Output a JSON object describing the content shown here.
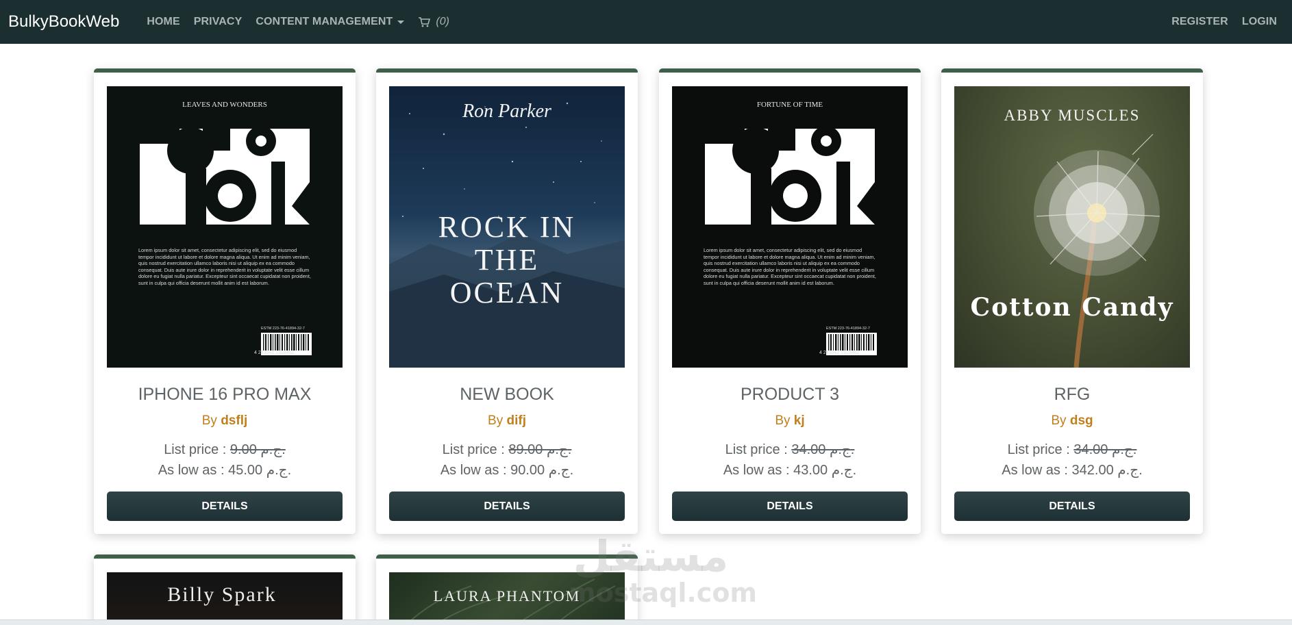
{
  "navbar": {
    "brand": "BulkyBookWeb",
    "links": [
      "HOME",
      "PRIVACY",
      "CONTENT MANAGEMENT"
    ],
    "cart_count": "(0)",
    "right_links": [
      "REGISTER",
      "LOGIN"
    ]
  },
  "products": [
    {
      "cover": {
        "line1": "LEAVES AND WONDERS",
        "big": "BOOK",
        "blurb": "Lorem ipsum dolor sit amet, consectetur adipiscing elit, sed do eiusmod tempor incididunt ut labore et dolore magna aliqua. Ut enim ad minim veniam, quis nostrud exercitation ullamco laboris nisi ut aliquip ex ea commodo consequat. Duis aute irure dolor in reprehenderit in voluptate velit esse cillum dolore eu fugiat nulla pariatur. Excepteur sint occaecat cupidatat non proident, sunt in culpa qui officia deserunt mollit anim id est laborum.",
        "isbn": "ESTM 223-76-41894-32-7",
        "barcode": "4 293042 1928462"
      },
      "title": "IPHONE 16 PRO MAX",
      "by": "By",
      "author": "dsflj",
      "list_label": "List price : ",
      "list_price": "9.00 ج.م.",
      "low_label": "As low as : ",
      "low_price": "45.00 ج.م.",
      "button": "DETAILS"
    },
    {
      "cover": {
        "author": "Ron Parker",
        "title_lines": [
          "ROCK IN",
          "THE",
          "OCEAN"
        ]
      },
      "title": "NEW BOOK",
      "by": "By",
      "author": "difj",
      "list_label": "List price : ",
      "list_price": "89.00 ج.م.",
      "low_label": "As low as : ",
      "low_price": "90.00 ج.م.",
      "button": "DETAILS"
    },
    {
      "cover": {
        "line1": "FORTUNE OF TIME",
        "big": "BOOK",
        "blurb": "Lorem ipsum dolor sit amet, consectetur adipiscing elit, sed do eiusmod tempor incididunt ut labore et dolore magna aliqua. Ut enim ad minim veniam, quis nostrud exercitation ullamco laboris nisi ut aliquip ex ea commodo consequat. Duis aute irure dolor in reprehenderit in voluptate velit esse cillum dolore eu fugiat nulla pariatur. Excepteur sint occaecat cupidatat non proident, sunt in culpa qui officia deserunt mollit anim id est laborum.",
        "isbn": "ESTM 223-76-41894-32-7",
        "barcode": "4 293042 1928462"
      },
      "title": "PRODUCT 3",
      "by": "By",
      "author": "kj",
      "list_label": "List price : ",
      "list_price": "34.00 ج.م.",
      "low_label": "As low as : ",
      "low_price": "43.00 ج.م.",
      "button": "DETAILS"
    },
    {
      "cover": {
        "author": "ABBY MUSCLES",
        "title": "Cotton Candy"
      },
      "title": "RFG",
      "by": "By",
      "author": "dsg",
      "list_label": "List price : ",
      "list_price": "34.00 ج.م.",
      "low_label": "As low as : ",
      "low_price": "342.00 ج.م.",
      "button": "DETAILS"
    }
  ],
  "partial_products": [
    {
      "cover_text": "Billy Spark"
    },
    {
      "cover_text": "LAURA PHANTOM"
    }
  ],
  "watermark": {
    "arabic": "مستقل",
    "latin": "mostaql.com"
  }
}
